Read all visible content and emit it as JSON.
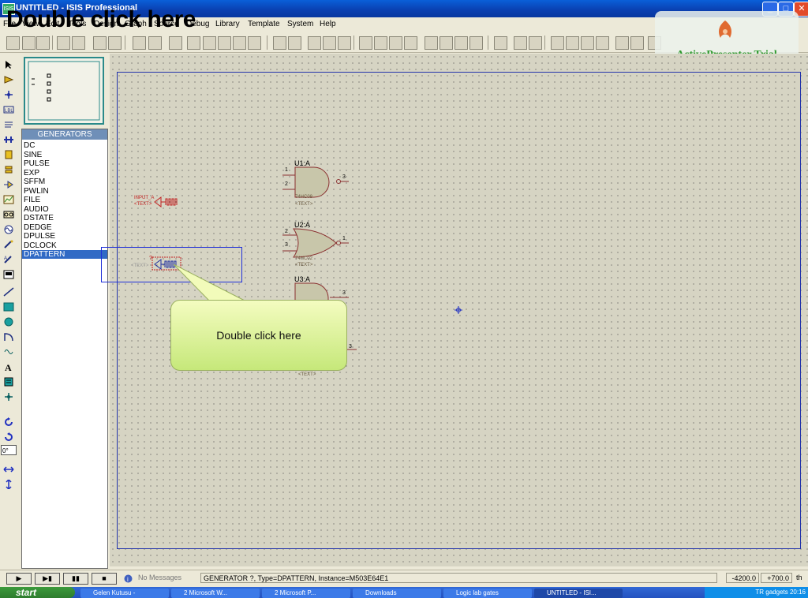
{
  "window": {
    "title": "UNTITLED - ISIS Professional",
    "overlay_caption": "Double click here"
  },
  "menu": [
    "File",
    "View",
    "Edit",
    "Tools",
    "Design",
    "Graph",
    "Source",
    "Debug",
    "Library",
    "Template",
    "System",
    "Help"
  ],
  "watermark": "ActivePresenter Trial",
  "device_list": {
    "header": "GENERATORS",
    "items": [
      "DC",
      "SINE",
      "PULSE",
      "EXP",
      "SFFM",
      "PWLIN",
      "FILE",
      "AUDIO",
      "DSTATE",
      "DEDGE",
      "DPULSE",
      "DCLOCK",
      "DPATTERN"
    ],
    "selected": "DPATTERN"
  },
  "schematic": {
    "gates": [
      {
        "label": "U1:A",
        "part": "74HC08",
        "in_pins": [
          "1",
          "2"
        ],
        "out_pin": "3"
      },
      {
        "label": "U2:A",
        "part": "74HC02",
        "in_pins": [
          "2",
          "3"
        ],
        "out_pin": "1"
      },
      {
        "label": "U3:A",
        "part": "",
        "in_pins": [],
        "out_pin": "3"
      }
    ],
    "extra_pin": "3",
    "text_placeholder": "<TEXT>",
    "gen1_label": "INPUT_A",
    "gen_qmark": "?"
  },
  "callout": {
    "text": "Double click here"
  },
  "status": {
    "messages": "No Messages",
    "info": "GENERATOR ?, Type=DPATTERN, Instance=M503E64E1",
    "x": "-4200.0",
    "y": "+700.0",
    "units": "th",
    "rotation": "0°"
  },
  "playback": [
    "▶",
    "▶▮",
    "▮▮",
    "■"
  ],
  "taskbar": {
    "start": "start",
    "tasks": [
      "Gelen Kutusu -",
      "2 Microsoft W...",
      "2 Microsoft P...",
      "Downloads",
      "Logic lab gates",
      "UNTITLED - ISI..."
    ],
    "tray": "TR   gadgets   20:16"
  }
}
